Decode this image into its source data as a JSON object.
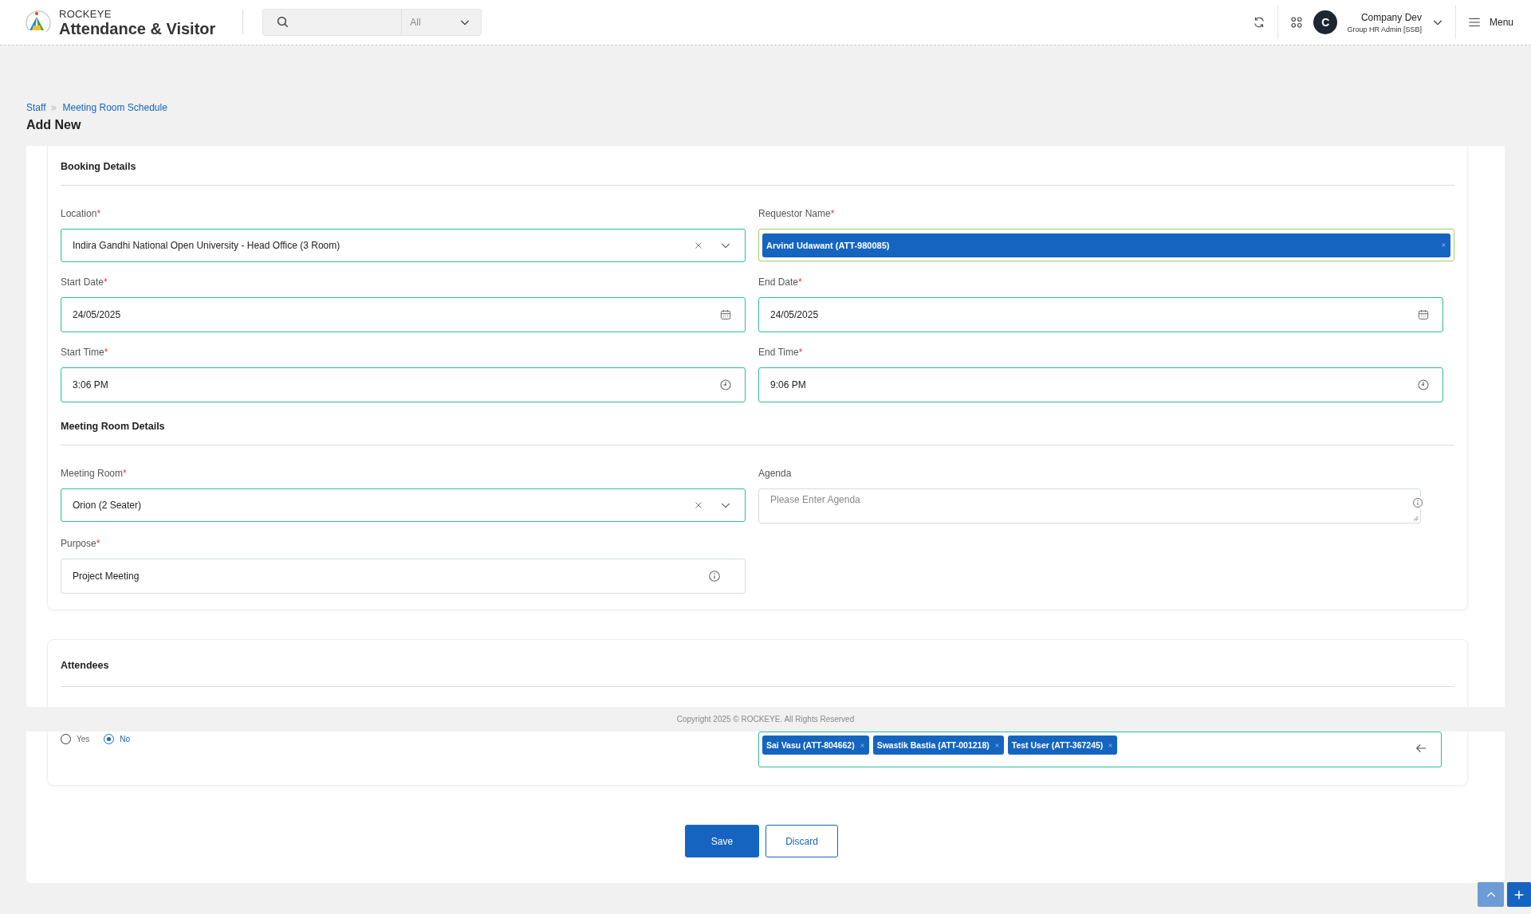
{
  "header": {
    "brand_top": "ROCKEYE",
    "brand": "Attendance & Visitor",
    "search": {
      "filter": "All"
    },
    "user": {
      "avatar": "C",
      "name": "Company Dev",
      "role": "Group HR Admin [SSB]"
    },
    "menu": "Menu"
  },
  "breadcrumb": [
    {
      "label": "Staff"
    },
    {
      "label": "Meeting Room Schedule"
    }
  ],
  "page_title": "Add New",
  "sections": [
    {
      "title": "Booking Details",
      "fields": [
        {
          "kind": "select",
          "label": "Location",
          "required_mark": "*",
          "value": "Indira Gandhi National Open University - Head Office (3 Room)"
        },
        {
          "kind": "tags",
          "label": "Requestor Name",
          "required_mark": "*",
          "tags": [
            "Arvind Udawant (ATT-980085)"
          ]
        },
        {
          "kind": "date",
          "label": "Start Date",
          "required_mark": "*",
          "value": "24/05/2025"
        },
        {
          "kind": "date",
          "label": "End Date",
          "required_mark": "*",
          "value": "24/05/2025"
        },
        {
          "kind": "time",
          "label": "Start Time",
          "required_mark": "*",
          "value": "3:06 PM"
        },
        {
          "kind": "time",
          "label": "End Time",
          "required_mark": "*",
          "value": "9:06 PM"
        }
      ]
    },
    {
      "title": "Meeting Room Details",
      "fields": [
        {
          "kind": "select",
          "label": "Meeting Room",
          "required_mark": "*",
          "value": "Orion (2 Seater)"
        },
        {
          "kind": "textarea",
          "label": "Agenda",
          "placeholder": "Please Enter Agenda"
        },
        {
          "kind": "text",
          "label": "Purpose",
          "required_mark": "*",
          "value": "Project Meeting"
        }
      ]
    }
  ],
  "attendees": {
    "title": "Attendees",
    "options": [
      {
        "label": "Yes",
        "selected": false
      },
      {
        "label": "No",
        "selected": true
      }
    ],
    "tags": [
      "Sai Vasu (ATT-804662)",
      "Swastik Bastia (ATT-001218)",
      "Test User (ATT-367245)"
    ]
  },
  "buttons": [
    {
      "label": "Save",
      "kind": "primary"
    },
    {
      "label": "Discard",
      "kind": "secondary"
    }
  ],
  "footer": "Copyright 2025 © ROCKEYE. All Rights Reserved"
}
